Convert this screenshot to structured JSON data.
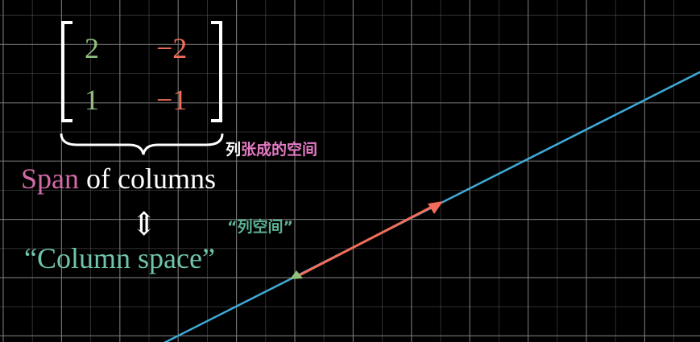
{
  "colors": {
    "background": "#000000",
    "grid": "#7f7f7f",
    "line": "#3fa9d6",
    "vector": "#f36d5a",
    "green": "#8ec07c",
    "red": "#f36d5a",
    "pink": "#d36aa9",
    "teal": "#71c4ac",
    "white": "#ffffff",
    "magenta_cn": "#e47ac4",
    "teal_cn": "#5ab293"
  },
  "matrix": {
    "r1c1": "2",
    "r1c2": "−2",
    "r2c1": "1",
    "r2c2": "−1"
  },
  "brace_label": {
    "part1": "列",
    "part2": "张成的空间"
  },
  "span_text": {
    "word": "Span",
    "rest": " of columns"
  },
  "equiv_symbol": "⇕",
  "column_space": "“Column space”",
  "column_space_cn": "“列空间”"
}
